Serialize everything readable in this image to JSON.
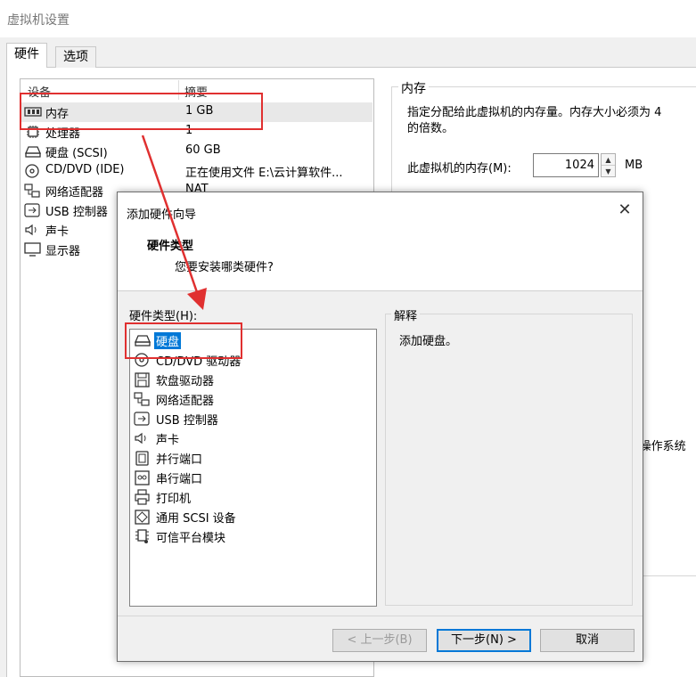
{
  "window": {
    "title": "虚拟机设置"
  },
  "tabs": [
    {
      "label": "硬件"
    },
    {
      "label": "选项"
    }
  ],
  "device_list": {
    "headers": {
      "device": "设备",
      "summary": "摘要"
    },
    "rows": [
      {
        "icon": "memory-icon",
        "name": "内存",
        "summary": "1 GB"
      },
      {
        "icon": "cpu-icon",
        "name": "处理器",
        "summary": "1"
      },
      {
        "icon": "hard-disk-icon",
        "name": "硬盘 (SCSI)",
        "summary": "60 GB"
      },
      {
        "icon": "cd-dvd-icon",
        "name": "CD/DVD (IDE)",
        "summary": "正在使用文件 E:\\云计算软件..."
      },
      {
        "icon": "network-adapter-icon",
        "name": "网络适配器",
        "summary": "NAT"
      },
      {
        "icon": "usb-icon",
        "name": "USB 控制器",
        "summary": ""
      },
      {
        "icon": "sound-icon",
        "name": "声卡",
        "summary": ""
      },
      {
        "icon": "display-icon",
        "name": "显示器",
        "summary": ""
      }
    ]
  },
  "memory_panel": {
    "title": "内存",
    "desc1": "指定分配给此虚拟机的内存量。内存大小必须为 4",
    "desc2": "的倍数。",
    "label": "此虚拟机的内存(M):",
    "value": "1024",
    "unit": "MB",
    "os_fragment": "l操作系统"
  },
  "dialog": {
    "title": "添加硬件向导",
    "heading": "硬件类型",
    "subheading": "您要安装哪类硬件?",
    "list_label": "硬件类型(H):",
    "items": [
      {
        "icon": "hard-disk-icon",
        "label": "硬盘"
      },
      {
        "icon": "cd-dvd-icon",
        "label": "CD/DVD 驱动器"
      },
      {
        "icon": "floppy-icon",
        "label": "软盘驱动器"
      },
      {
        "icon": "network-adapter-icon",
        "label": "网络适配器"
      },
      {
        "icon": "usb-icon",
        "label": "USB 控制器"
      },
      {
        "icon": "sound-icon",
        "label": "声卡"
      },
      {
        "icon": "parallel-port-icon",
        "label": "并行端口"
      },
      {
        "icon": "serial-port-icon",
        "label": "串行端口"
      },
      {
        "icon": "printer-icon",
        "label": "打印机"
      },
      {
        "icon": "scsi-icon",
        "label": "通用 SCSI 设备"
      },
      {
        "icon": "tpm-icon",
        "label": "可信平台模块"
      }
    ],
    "desc_title": "解释",
    "desc_text": "添加硬盘。",
    "buttons": {
      "back": "< 上一步(B)",
      "next": "下一步(N) >",
      "cancel": "取消"
    }
  },
  "colors": {
    "annotation": "#e03030",
    "selection": "#0078d7"
  }
}
